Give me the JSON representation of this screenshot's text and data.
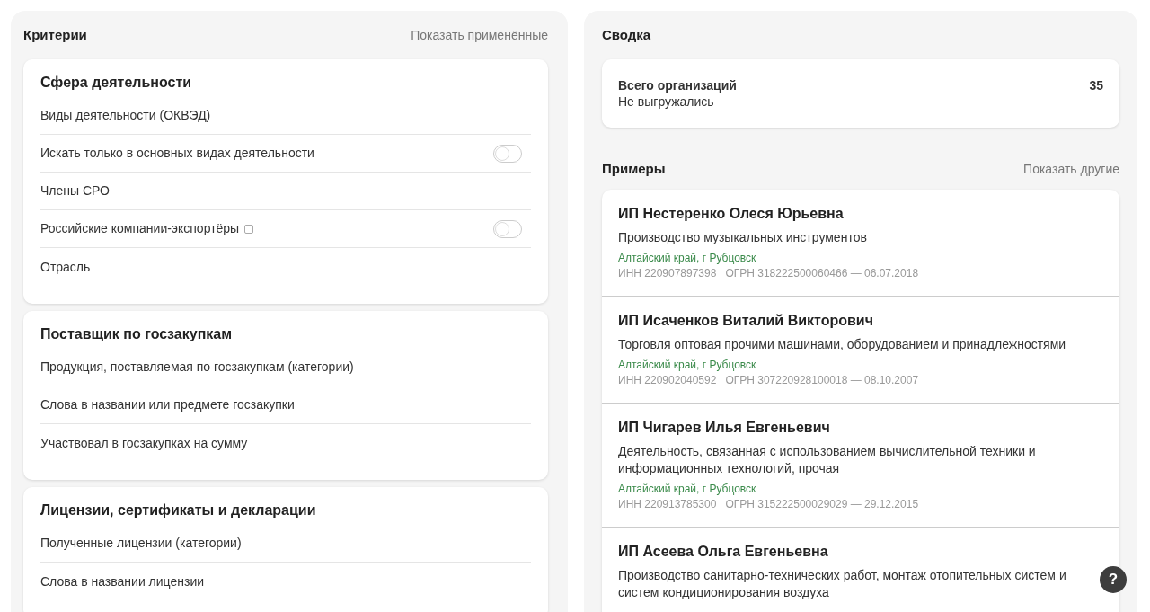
{
  "criteria": {
    "title": "Критерии",
    "action": "Показать применённые",
    "sections": [
      {
        "title": "Сфера деятельности",
        "items": [
          {
            "kind": "link",
            "label": "Виды деятельности (ОКВЭД)",
            "hint": false
          },
          {
            "kind": "toggle",
            "label": "Искать только в основных видах деятельности",
            "on": false,
            "hint": false
          },
          {
            "kind": "link",
            "label": "Члены СРО",
            "hint": false
          },
          {
            "kind": "toggle",
            "label": "Российские компании-экспортёры",
            "on": false,
            "hint": true
          },
          {
            "kind": "link",
            "label": "Отрасль",
            "hint": false
          }
        ]
      },
      {
        "title": "Поставщик по госзакупкам",
        "items": [
          {
            "kind": "link",
            "label": "Продукция, поставляемая по госзакупкам (категории)",
            "hint": false
          },
          {
            "kind": "link",
            "label": "Слова в названии или предмете госзакупки",
            "hint": false
          },
          {
            "kind": "link",
            "label": "Участвовал в госзакупках на сумму",
            "hint": false
          }
        ]
      },
      {
        "title": "Лицензии, сертификаты и декларации",
        "items": [
          {
            "kind": "link",
            "label": "Полученные лицензии (категории)",
            "hint": false
          },
          {
            "kind": "link",
            "label": "Слова в названии лицензии",
            "hint": false
          }
        ]
      }
    ]
  },
  "summary": {
    "title": "Сводка",
    "label": "Всего организаций",
    "count": "35",
    "note": "Не выгружались"
  },
  "examples": {
    "title": "Примеры",
    "action": "Показать другие",
    "items": [
      {
        "name": "ИП Нестеренко Олеся Юрьевна",
        "activity": "Производство музыкальных инструментов",
        "location": "Алтайский край, г Рубцовск",
        "inn": "ИНН 220907897398",
        "ogrn": "ОГРН 318222500060466 — 06.07.2018"
      },
      {
        "name": "ИП Исаченков Виталий Викторович",
        "activity": "Торговля оптовая прочими машинами, оборудованием и принадлежностями",
        "location": "Алтайский край, г Рубцовск",
        "inn": "ИНН 220902040592",
        "ogrn": "ОГРН 307220928100018 — 08.10.2007"
      },
      {
        "name": "ИП Чигарев Илья Евгеньевич",
        "activity": "Деятельность, связанная с использованием вычислительной техники и информационных технологий, прочая",
        "location": "Алтайский край, г Рубцовск",
        "inn": "ИНН 220913785300",
        "ogrn": "ОГРН 315222500029029 — 29.12.2015"
      },
      {
        "name": "ИП Асеева Ольга Евгеньевна",
        "activity": "Производство санитарно-технических работ, монтаж отопительных систем и систем кондиционирования воздуха"
      }
    ]
  },
  "help_button": "?"
}
